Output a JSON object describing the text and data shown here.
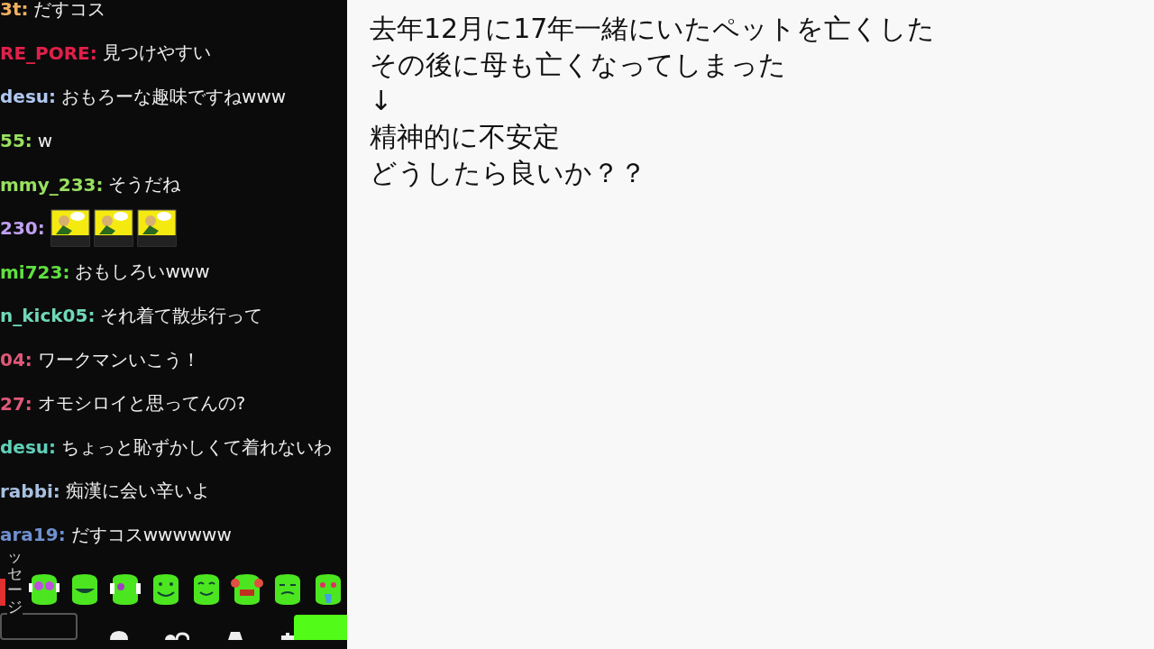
{
  "chat": {
    "messages": [
      {
        "kind": "text",
        "user": "3t:",
        "color": "#f0b060",
        "text": "だすコス"
      },
      {
        "kind": "text",
        "user": "RE_PORE:",
        "color": "#e0204a",
        "text": "見つけやすい"
      },
      {
        "kind": "text",
        "user": "desu:",
        "color": "#b0c8f0",
        "text": "おもろーな趣味ですねwww"
      },
      {
        "kind": "text",
        "user": "55:",
        "color": "#98e060",
        "text": "w"
      },
      {
        "kind": "text",
        "user": "mmy_233:",
        "color": "#98e060",
        "text": "そうだね"
      },
      {
        "kind": "emotes",
        "user": "230:",
        "color": "#c0a0f0",
        "emotes": [
          {
            "kind": "sticker"
          },
          {
            "kind": "sticker"
          },
          {
            "kind": "sticker"
          }
        ]
      },
      {
        "kind": "text",
        "user": "mi723:",
        "color": "#60e040",
        "text": "おもしろいwww"
      },
      {
        "kind": "text",
        "user": "n_kick05:",
        "color": "#70d8b8",
        "text": "それ着て散歩行って"
      },
      {
        "kind": "text",
        "user": "04:",
        "color": "#e05878",
        "text": "ワークマンいこう！"
      },
      {
        "kind": "text",
        "user": "27:",
        "color": "#e05878",
        "text": "オモシロイと思ってんの?"
      },
      {
        "kind": "text",
        "user": "desu:",
        "color": "#60d0b8",
        "text": "ちょっと恥ずかしくて着れないわ"
      },
      {
        "kind": "text",
        "user": "rabbi:",
        "color": "#a8c0e0",
        "text": "痴漢に会い辛いよ"
      },
      {
        "kind": "text",
        "user": "ara19:",
        "color": "#7090d0",
        "text": "だすコスwwwwww"
      }
    ],
    "side_label": "ッセージ",
    "emote_bar": [
      {
        "kind": "goggles"
      },
      {
        "kind": "grin"
      },
      {
        "kind": "headphones"
      },
      {
        "kind": "smile"
      },
      {
        "kind": "happy"
      },
      {
        "kind": "clown"
      },
      {
        "kind": "sly"
      },
      {
        "kind": "love"
      }
    ]
  },
  "note": {
    "lines": [
      "去年12月に17年一緒にいたペットを亡くした",
      "その後に母も亡くなってしまった",
      "↓",
      "精神的に不安定",
      "どうしたら良いか？？"
    ]
  }
}
